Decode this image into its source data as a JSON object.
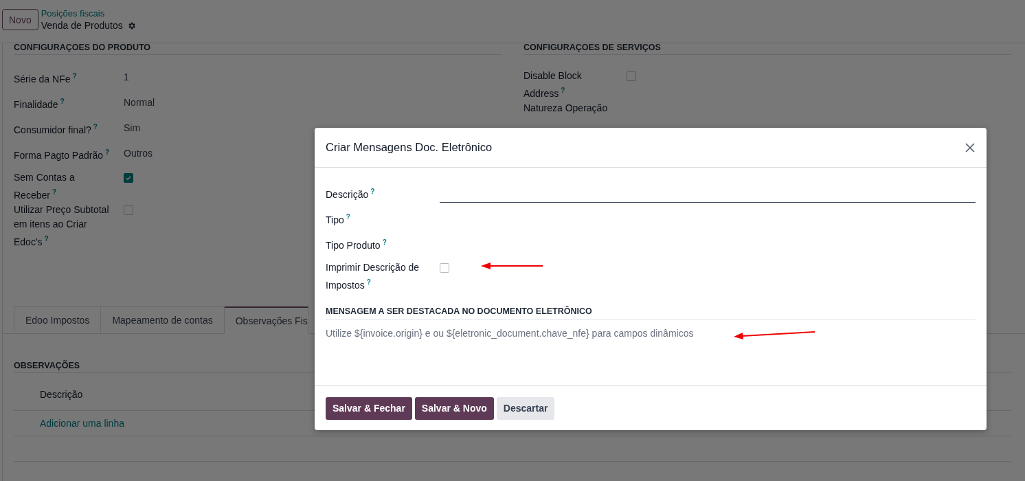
{
  "control_panel": {
    "new_button": "Novo",
    "breadcrumb": "Posições fiscais",
    "record_title": "Venda de Produtos"
  },
  "product_settings": {
    "title": "CONFIGURAÇOES DO PRODUTO",
    "fields": [
      {
        "label": "Série da NFe",
        "help": "?",
        "kind": "text",
        "value": "1"
      },
      {
        "label": "Finalidade",
        "help": "?",
        "kind": "text",
        "value": "Normal"
      },
      {
        "label": "Consumidor final?",
        "help": "?",
        "kind": "text",
        "value": "Sim"
      },
      {
        "label": "Forma Pagto Padrão",
        "help": "?",
        "kind": "text",
        "value": "Outros"
      },
      {
        "label": "Sem Contas a Receber",
        "help": "?",
        "kind": "checkbox",
        "checked": true
      },
      {
        "label": "Utilizar Preço Subtotal em itens ao Criar Edoc's",
        "help": "?",
        "kind": "checkbox",
        "checked": false
      }
    ]
  },
  "service_settings": {
    "title": "CONFIGURAÇOES DE SERVIÇOS",
    "fields": [
      {
        "label": "Disable Block Address",
        "help": "?",
        "kind": "checkbox",
        "checked": false
      },
      {
        "label": "Natureza Operação",
        "kind": "text"
      }
    ]
  },
  "tabs": [
    {
      "label": "Edoo Impostos",
      "selected": false
    },
    {
      "label": "Mapeamento de contas",
      "selected": false
    },
    {
      "label": "Observações Fis",
      "selected": true
    }
  ],
  "observations": {
    "title": "OBSERVAÇÕES",
    "columns": [
      "Descrição"
    ],
    "add_line": "Adicionar uma linha"
  },
  "dialog": {
    "title": "Criar Mensagens Doc. Eletrônico",
    "fields": [
      {
        "label": "Descrição",
        "help": "?",
        "kind": "input"
      },
      {
        "label": "Tipo",
        "help": "?",
        "kind": "selection"
      },
      {
        "label": "Tipo Produto",
        "help": "?",
        "kind": "selection"
      },
      {
        "label": "Imprimir Descrição de Impostos",
        "help": "?",
        "kind": "checkbox",
        "checked": false
      }
    ],
    "section_title": "MENSAGEM A SER DESTACADA NO DOCUMENTO ELETRÔNICO",
    "message": {
      "placeholder": "Utilize ${invoice.origin} e ou ${eletronic_document.chave_nfe} para campos dinâmicos"
    },
    "buttons": [
      {
        "label": "Salvar & Fechar",
        "kind": "primary"
      },
      {
        "label": "Salvar & Novo",
        "kind": "primary"
      },
      {
        "label": "Descartar",
        "kind": "secondary"
      }
    ]
  }
}
